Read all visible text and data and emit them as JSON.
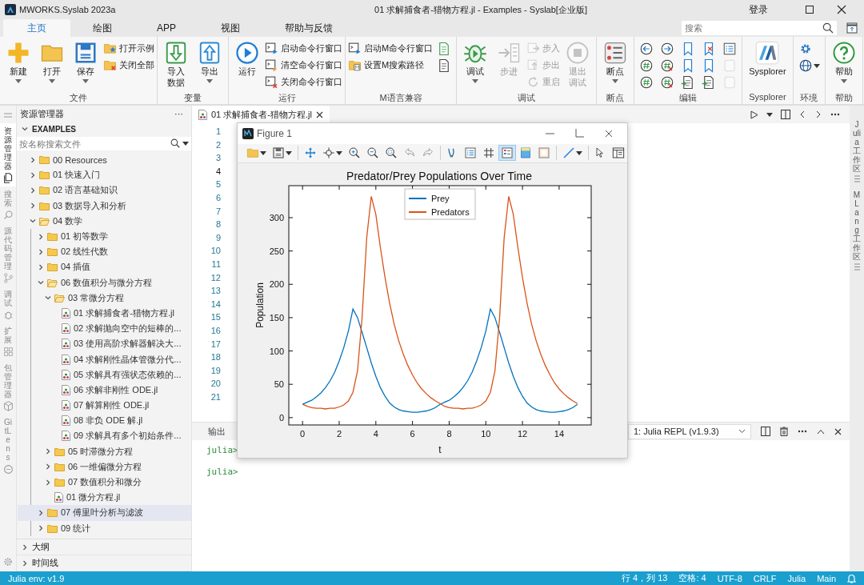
{
  "title_bar": {
    "app_name": "MWORKS.Syslab 2023a",
    "document_title": "01 求解捕食者-猎物方程.jl - Examples - Syslab[企业版]",
    "login": "登录"
  },
  "ribbon_tabs": [
    {
      "label": "主页",
      "selected": true
    },
    {
      "label": "绘图",
      "selected": false
    },
    {
      "label": "APP",
      "selected": false
    },
    {
      "label": "视图",
      "selected": false
    },
    {
      "label": "帮助与反馈",
      "selected": false
    }
  ],
  "ribbon_search": {
    "placeholder": "搜索"
  },
  "ribbon_groups": [
    {
      "label": "文件",
      "columns": [
        {
          "kind": "large",
          "label": "新建",
          "dropdown": true,
          "disabled": false
        },
        {
          "kind": "large",
          "label": "打开",
          "dropdown": true,
          "disabled": false
        },
        {
          "kind": "large",
          "label": "保存",
          "dropdown": true,
          "disabled": false
        },
        {
          "kind": "stack",
          "items": [
            {
              "label": "打开示例",
              "disabled": false
            },
            {
              "label": "关闭全部",
              "disabled": false
            }
          ]
        }
      ]
    },
    {
      "label": "变量",
      "columns": [
        {
          "kind": "large",
          "label": "导入数据",
          "dropdown": false,
          "disabled": false
        },
        {
          "kind": "large",
          "label": "导出",
          "dropdown": true,
          "disabled": false
        }
      ]
    },
    {
      "label": "运行",
      "columns": [
        {
          "kind": "large",
          "label": "运行",
          "dropdown": false,
          "disabled": false
        },
        {
          "kind": "stack",
          "items": [
            {
              "label": "启动命令行窗口",
              "disabled": false
            },
            {
              "label": "清空命令行窗口",
              "disabled": false
            },
            {
              "label": "关闭命令行窗口",
              "disabled": false
            }
          ]
        }
      ]
    },
    {
      "label": "M语言兼容",
      "columns": [
        {
          "kind": "stack",
          "items": [
            {
              "label": "启动M命令行窗口",
              "disabled": false
            },
            {
              "label": "设置M搜索路径",
              "disabled": false
            }
          ]
        },
        {
          "kind": "icons",
          "items": [
            {
              "disabled": false
            },
            {
              "disabled": false
            }
          ]
        }
      ]
    },
    {
      "label": "调试",
      "columns": [
        {
          "kind": "large",
          "label": "调试",
          "dropdown": true,
          "disabled": false
        },
        {
          "kind": "large",
          "label": "步进",
          "dropdown": false,
          "disabled": true
        },
        {
          "kind": "stack",
          "items": [
            {
              "label": "步入",
              "disabled": true
            },
            {
              "label": "步出",
              "disabled": true
            },
            {
              "label": "重启",
              "disabled": true
            }
          ]
        },
        {
          "kind": "large",
          "label": "退出调试",
          "dropdown": false,
          "disabled": true
        }
      ]
    },
    {
      "label": "断点",
      "columns": [
        {
          "kind": "large",
          "label": "断点",
          "dropdown": true,
          "disabled": false
        }
      ]
    },
    {
      "label": "编辑",
      "columns": [
        {
          "kind": "icons",
          "items": [
            {
              "disabled": false
            },
            {
              "disabled": false
            },
            {
              "disabled": false
            }
          ]
        },
        {
          "kind": "icons",
          "items": [
            {
              "disabled": false
            },
            {
              "disabled": false
            },
            {
              "disabled": false
            }
          ]
        },
        {
          "kind": "icons",
          "items": [
            {
              "disabled": false
            },
            {
              "disabled": false
            },
            {
              "disabled": false
            }
          ]
        },
        {
          "kind": "icons",
          "items": [
            {
              "disabled": false
            },
            {
              "disabled": false
            },
            {
              "disabled": false
            }
          ]
        },
        {
          "kind": "icons",
          "items": [
            {
              "disabled": false
            },
            {
              "disabled": true
            },
            {
              "disabled": true
            }
          ]
        }
      ]
    },
    {
      "label": "Sysplorer",
      "columns": [
        {
          "kind": "large",
          "label": "Sysplorer",
          "dropdown": false,
          "disabled": false
        }
      ]
    },
    {
      "label": "环境",
      "columns": [
        {
          "kind": "icons",
          "items": [
            {
              "disabled": false,
              "dropdown": false
            },
            {
              "disabled": false,
              "dropdown": true
            }
          ]
        }
      ]
    },
    {
      "label": "帮助",
      "columns": [
        {
          "kind": "large",
          "label": "帮助",
          "dropdown": true,
          "disabled": false
        }
      ]
    }
  ],
  "activity_bar": [
    {
      "label": "资源管理器",
      "selected": true
    },
    {
      "label": "搜索",
      "selected": false
    },
    {
      "label": "源代码管理",
      "selected": false
    },
    {
      "label": "调试",
      "selected": false
    },
    {
      "label": "扩展",
      "selected": false
    },
    {
      "label": "包管理器",
      "selected": false
    },
    {
      "label": "GitLens",
      "selected": false
    }
  ],
  "sidebar": {
    "title": "资源管理器",
    "more": "···",
    "section": {
      "label": "EXAMPLES",
      "expanded": true
    },
    "search": {
      "placeholder": "按名称搜索文件"
    },
    "tree": [
      {
        "kind": "folder",
        "label": "00 Resources",
        "expanded": false,
        "selected": false
      },
      {
        "kind": "folder",
        "label": "01 快速入门",
        "expanded": false,
        "selected": false
      },
      {
        "kind": "folder",
        "label": "02 语言基础知识",
        "expanded": false,
        "selected": false
      },
      {
        "kind": "folder",
        "label": "03 数据导入和分析",
        "expanded": false,
        "selected": false
      },
      {
        "kind": "folder",
        "label": "04 数学",
        "expanded": true,
        "selected": false,
        "children": [
          {
            "kind": "folder",
            "label": "01 初等数学",
            "expanded": false,
            "selected": false
          },
          {
            "kind": "folder",
            "label": "02 线性代数",
            "expanded": false,
            "selected": false
          },
          {
            "kind": "folder",
            "label": "04 插值",
            "expanded": false,
            "selected": false
          },
          {
            "kind": "folder",
            "label": "06 数值积分与微分方程",
            "expanded": true,
            "selected": false,
            "children": [
              {
                "kind": "folder",
                "label": "03 常微分方程",
                "expanded": true,
                "selected": false,
                "children": [
                  {
                    "kind": "file",
                    "label": "01 求解捕食者-猎物方程.jl",
                    "selected": false
                  },
                  {
                    "kind": "file",
                    "label": "02 求解抛向空中的短棒的...",
                    "selected": false
                  },
                  {
                    "kind": "file",
                    "label": "03 使用高阶求解器解决大...",
                    "selected": false
                  },
                  {
                    "kind": "file",
                    "label": "04 求解刚性晶体管微分代...",
                    "selected": false
                  },
                  {
                    "kind": "file",
                    "label": "05 求解具有强状态依赖的...",
                    "selected": false
                  },
                  {
                    "kind": "file",
                    "label": "06 求解非刚性 ODE.jl",
                    "selected": false
                  },
                  {
                    "kind": "file",
                    "label": "07 解算刚性 ODE.jl",
                    "selected": false
                  },
                  {
                    "kind": "file",
                    "label": "08 非负 ODE 解.jl",
                    "selected": false
                  },
                  {
                    "kind": "file",
                    "label": "09 求解具有多个初始条件...",
                    "selected": false
                  }
                ]
              },
              {
                "kind": "folder",
                "label": "05 时滞微分方程",
                "expanded": false,
                "selected": false
              },
              {
                "kind": "folder",
                "label": "06 一维偏微分方程",
                "expanded": false,
                "selected": false
              },
              {
                "kind": "folder",
                "label": "07 数值积分和微分",
                "expanded": false,
                "selected": false
              },
              {
                "kind": "file",
                "label": "01 微分方程.jl",
                "selected": false
              }
            ]
          },
          {
            "kind": "folder",
            "label": "07 傅里叶分析与滤波",
            "expanded": false,
            "selected": true
          },
          {
            "kind": "folder",
            "label": "09 统计",
            "expanded": false,
            "selected": false
          }
        ]
      }
    ],
    "footer_sections": [
      {
        "label": "大纲",
        "expanded": false
      },
      {
        "label": "时间线",
        "expanded": false
      }
    ]
  },
  "editor": {
    "tabs": [
      {
        "label": "01 求解捕食者-猎物方程.jl",
        "selected": true
      }
    ],
    "line_numbers": [
      {
        "number": "1",
        "current": false
      },
      {
        "number": "2",
        "current": false
      },
      {
        "number": "3",
        "current": false
      },
      {
        "number": "4",
        "current": true
      },
      {
        "number": "5",
        "current": false
      },
      {
        "number": "6",
        "current": false
      },
      {
        "number": "7",
        "current": false
      },
      {
        "number": "8",
        "current": false
      },
      {
        "number": "9",
        "current": false
      },
      {
        "number": "10",
        "current": false
      },
      {
        "number": "11",
        "current": false
      },
      {
        "number": "12",
        "current": false
      },
      {
        "number": "13",
        "current": false
      },
      {
        "number": "14",
        "current": false
      },
      {
        "number": "15",
        "current": false
      },
      {
        "number": "16",
        "current": false
      },
      {
        "number": "17",
        "current": false
      },
      {
        "number": "18",
        "current": false
      },
      {
        "number": "19",
        "current": false
      },
      {
        "number": "20",
        "current": false
      },
      {
        "number": "21",
        "current": false
      }
    ]
  },
  "panel": {
    "tabs": [
      {
        "label": "输出",
        "selected": false
      }
    ],
    "terminal_select": "1: Julia REPL (v1.9.3)",
    "prompts": [
      "julia>",
      "julia>"
    ]
  },
  "right_bar": [
    {
      "label": "Julia 工作区"
    },
    {
      "label": "MLang 工作区"
    }
  ],
  "figure": {
    "title": "Figure 1",
    "tools": [
      {
        "selected": false,
        "dropdown": true
      },
      {
        "selected": false,
        "dropdown": true
      },
      {
        "selected": false,
        "dropdown": false
      },
      {
        "selected": false,
        "dropdown": true
      },
      {
        "selected": false,
        "dropdown": false
      },
      {
        "selected": false,
        "dropdown": false
      },
      {
        "selected": false,
        "dropdown": false
      },
      {
        "selected": false,
        "dropdown": false
      },
      {
        "selected": false,
        "dropdown": false
      },
      {
        "selected": false,
        "dropdown": false
      },
      {
        "selected": false,
        "dropdown": false
      },
      {
        "selected": false,
        "dropdown": false
      },
      {
        "selected": true,
        "dropdown": false
      },
      {
        "selected": false,
        "dropdown": false
      },
      {
        "selected": false,
        "dropdown": false
      },
      {
        "selected": false,
        "dropdown": true
      },
      {
        "selected": false,
        "dropdown": false
      },
      {
        "selected": false,
        "dropdown": false
      }
    ],
    "chart_data": {
      "type": "line",
      "title": "Predator/Prey Populations Over Time",
      "xlabel": "t",
      "ylabel": "Population",
      "x": [
        0,
        0.25,
        0.5,
        0.75,
        1,
        1.25,
        1.5,
        1.75,
        2,
        2.25,
        2.5,
        2.75,
        3,
        3.25,
        3.5,
        3.75,
        4,
        4.25,
        4.5,
        4.75,
        5,
        5.25,
        5.5,
        5.75,
        6,
        6.25,
        6.5,
        6.75,
        7,
        7.25,
        7.5,
        7.75,
        8,
        8.25,
        8.5,
        8.75,
        9,
        9.25,
        9.5,
        9.75,
        10,
        10.25,
        10.5,
        10.75,
        11,
        11.25,
        11.5,
        11.75,
        12,
        12.25,
        12.5,
        12.75,
        13,
        13.25,
        13.5,
        13.75,
        14,
        14.25,
        14.5,
        14.75,
        15
      ],
      "series": [
        {
          "name": "Prey",
          "color": "#0072bd",
          "values": [
            20,
            23,
            26,
            31,
            37,
            45,
            55,
            68,
            85,
            105,
            130,
            163,
            150,
            128,
            105,
            82,
            62,
            45,
            32,
            22,
            16,
            12,
            10,
            9,
            8,
            8,
            9,
            10,
            12,
            15,
            20,
            23,
            26,
            31,
            37,
            45,
            55,
            68,
            85,
            105,
            130,
            163,
            150,
            128,
            105,
            82,
            62,
            45,
            32,
            22,
            16,
            12,
            10,
            9,
            8,
            8,
            9,
            10,
            12,
            15,
            20
          ]
        },
        {
          "name": "Predators",
          "color": "#d95319",
          "values": [
            20,
            17,
            15,
            14,
            14,
            13,
            14,
            14,
            16,
            19,
            25,
            38,
            70,
            150,
            270,
            332,
            305,
            255,
            210,
            172,
            140,
            115,
            95,
            78,
            64,
            52,
            43,
            36,
            30,
            25,
            21,
            17,
            15,
            14,
            14,
            13,
            14,
            14,
            16,
            19,
            25,
            38,
            70,
            150,
            270,
            332,
            305,
            255,
            210,
            172,
            140,
            115,
            95,
            78,
            64,
            52,
            43,
            36,
            30,
            25,
            21
          ]
        }
      ],
      "legend": "top",
      "xlim": [
        -0.75,
        15.75
      ],
      "ylim": [
        -11,
        348
      ],
      "xticks": [
        0,
        2,
        4,
        6,
        8,
        10,
        12,
        14
      ],
      "yticks": [
        0,
        50,
        100,
        150,
        200,
        250,
        300
      ]
    }
  },
  "status_bar": {
    "left": "Julia env: v1.9",
    "right": [
      "行 4，列 13",
      "空格: 4",
      "UTF-8",
      "CRLF",
      "Julia",
      "Main"
    ]
  }
}
